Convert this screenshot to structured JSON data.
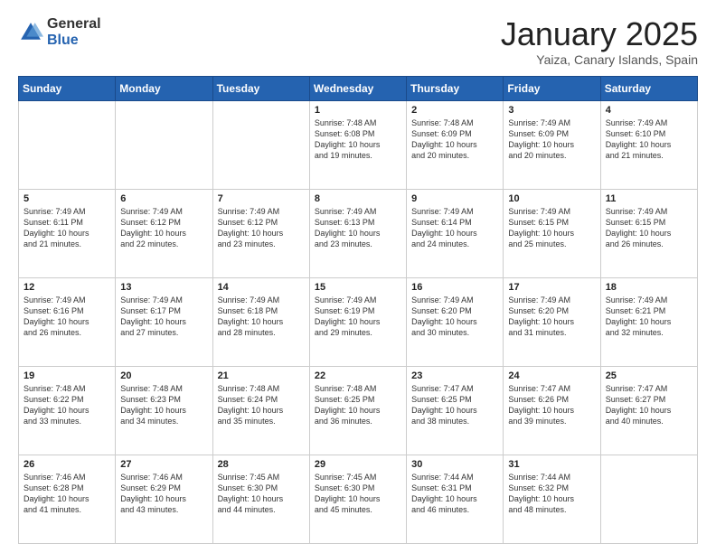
{
  "logo": {
    "general": "General",
    "blue": "Blue"
  },
  "title": {
    "month": "January 2025",
    "location": "Yaiza, Canary Islands, Spain"
  },
  "weekdays": [
    "Sunday",
    "Monday",
    "Tuesday",
    "Wednesday",
    "Thursday",
    "Friday",
    "Saturday"
  ],
  "weeks": [
    [
      {
        "day": "",
        "info": ""
      },
      {
        "day": "",
        "info": ""
      },
      {
        "day": "",
        "info": ""
      },
      {
        "day": "1",
        "info": "Sunrise: 7:48 AM\nSunset: 6:08 PM\nDaylight: 10 hours\nand 19 minutes."
      },
      {
        "day": "2",
        "info": "Sunrise: 7:48 AM\nSunset: 6:09 PM\nDaylight: 10 hours\nand 20 minutes."
      },
      {
        "day": "3",
        "info": "Sunrise: 7:49 AM\nSunset: 6:09 PM\nDaylight: 10 hours\nand 20 minutes."
      },
      {
        "day": "4",
        "info": "Sunrise: 7:49 AM\nSunset: 6:10 PM\nDaylight: 10 hours\nand 21 minutes."
      }
    ],
    [
      {
        "day": "5",
        "info": "Sunrise: 7:49 AM\nSunset: 6:11 PM\nDaylight: 10 hours\nand 21 minutes."
      },
      {
        "day": "6",
        "info": "Sunrise: 7:49 AM\nSunset: 6:12 PM\nDaylight: 10 hours\nand 22 minutes."
      },
      {
        "day": "7",
        "info": "Sunrise: 7:49 AM\nSunset: 6:12 PM\nDaylight: 10 hours\nand 23 minutes."
      },
      {
        "day": "8",
        "info": "Sunrise: 7:49 AM\nSunset: 6:13 PM\nDaylight: 10 hours\nand 23 minutes."
      },
      {
        "day": "9",
        "info": "Sunrise: 7:49 AM\nSunset: 6:14 PM\nDaylight: 10 hours\nand 24 minutes."
      },
      {
        "day": "10",
        "info": "Sunrise: 7:49 AM\nSunset: 6:15 PM\nDaylight: 10 hours\nand 25 minutes."
      },
      {
        "day": "11",
        "info": "Sunrise: 7:49 AM\nSunset: 6:15 PM\nDaylight: 10 hours\nand 26 minutes."
      }
    ],
    [
      {
        "day": "12",
        "info": "Sunrise: 7:49 AM\nSunset: 6:16 PM\nDaylight: 10 hours\nand 26 minutes."
      },
      {
        "day": "13",
        "info": "Sunrise: 7:49 AM\nSunset: 6:17 PM\nDaylight: 10 hours\nand 27 minutes."
      },
      {
        "day": "14",
        "info": "Sunrise: 7:49 AM\nSunset: 6:18 PM\nDaylight: 10 hours\nand 28 minutes."
      },
      {
        "day": "15",
        "info": "Sunrise: 7:49 AM\nSunset: 6:19 PM\nDaylight: 10 hours\nand 29 minutes."
      },
      {
        "day": "16",
        "info": "Sunrise: 7:49 AM\nSunset: 6:20 PM\nDaylight: 10 hours\nand 30 minutes."
      },
      {
        "day": "17",
        "info": "Sunrise: 7:49 AM\nSunset: 6:20 PM\nDaylight: 10 hours\nand 31 minutes."
      },
      {
        "day": "18",
        "info": "Sunrise: 7:49 AM\nSunset: 6:21 PM\nDaylight: 10 hours\nand 32 minutes."
      }
    ],
    [
      {
        "day": "19",
        "info": "Sunrise: 7:48 AM\nSunset: 6:22 PM\nDaylight: 10 hours\nand 33 minutes."
      },
      {
        "day": "20",
        "info": "Sunrise: 7:48 AM\nSunset: 6:23 PM\nDaylight: 10 hours\nand 34 minutes."
      },
      {
        "day": "21",
        "info": "Sunrise: 7:48 AM\nSunset: 6:24 PM\nDaylight: 10 hours\nand 35 minutes."
      },
      {
        "day": "22",
        "info": "Sunrise: 7:48 AM\nSunset: 6:25 PM\nDaylight: 10 hours\nand 36 minutes."
      },
      {
        "day": "23",
        "info": "Sunrise: 7:47 AM\nSunset: 6:25 PM\nDaylight: 10 hours\nand 38 minutes."
      },
      {
        "day": "24",
        "info": "Sunrise: 7:47 AM\nSunset: 6:26 PM\nDaylight: 10 hours\nand 39 minutes."
      },
      {
        "day": "25",
        "info": "Sunrise: 7:47 AM\nSunset: 6:27 PM\nDaylight: 10 hours\nand 40 minutes."
      }
    ],
    [
      {
        "day": "26",
        "info": "Sunrise: 7:46 AM\nSunset: 6:28 PM\nDaylight: 10 hours\nand 41 minutes."
      },
      {
        "day": "27",
        "info": "Sunrise: 7:46 AM\nSunset: 6:29 PM\nDaylight: 10 hours\nand 43 minutes."
      },
      {
        "day": "28",
        "info": "Sunrise: 7:45 AM\nSunset: 6:30 PM\nDaylight: 10 hours\nand 44 minutes."
      },
      {
        "day": "29",
        "info": "Sunrise: 7:45 AM\nSunset: 6:30 PM\nDaylight: 10 hours\nand 45 minutes."
      },
      {
        "day": "30",
        "info": "Sunrise: 7:44 AM\nSunset: 6:31 PM\nDaylight: 10 hours\nand 46 minutes."
      },
      {
        "day": "31",
        "info": "Sunrise: 7:44 AM\nSunset: 6:32 PM\nDaylight: 10 hours\nand 48 minutes."
      },
      {
        "day": "",
        "info": ""
      }
    ]
  ]
}
